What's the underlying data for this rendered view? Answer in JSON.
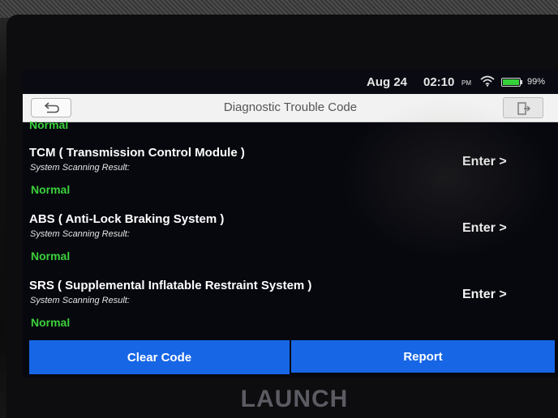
{
  "status_bar": {
    "date": "Aug 24",
    "time": "02:10",
    "ampm": "PM",
    "battery_percent": "99%",
    "battery_level": 0.99,
    "wifi_icon": "wifi-icon",
    "battery_icon": "battery-icon"
  },
  "header": {
    "title": "Diagnostic Trouble Code",
    "back_icon": "back-arrow-icon",
    "exit_icon": "exit-icon"
  },
  "partial_item": {
    "status": "Normal"
  },
  "modules": [
    {
      "title": "TCM ( Transmission Control Module )",
      "label": "System Scanning Result:",
      "status": "Normal",
      "enter_label": "Enter >"
    },
    {
      "title": "ABS ( Anti-Lock Braking System )",
      "label": "System Scanning Result:",
      "status": "Normal",
      "enter_label": "Enter >"
    },
    {
      "title": "SRS ( Supplemental Inflatable Restraint System )",
      "label": "System Scanning Result:",
      "status": "Normal",
      "enter_label": "Enter >"
    }
  ],
  "actions": {
    "clear_code": "Clear Code",
    "report": "Report"
  },
  "brand": "LAUNCH",
  "colors": {
    "accent_blue": "#1766e6",
    "status_green": "#3bd13b",
    "battery_green": "#35d13a"
  }
}
